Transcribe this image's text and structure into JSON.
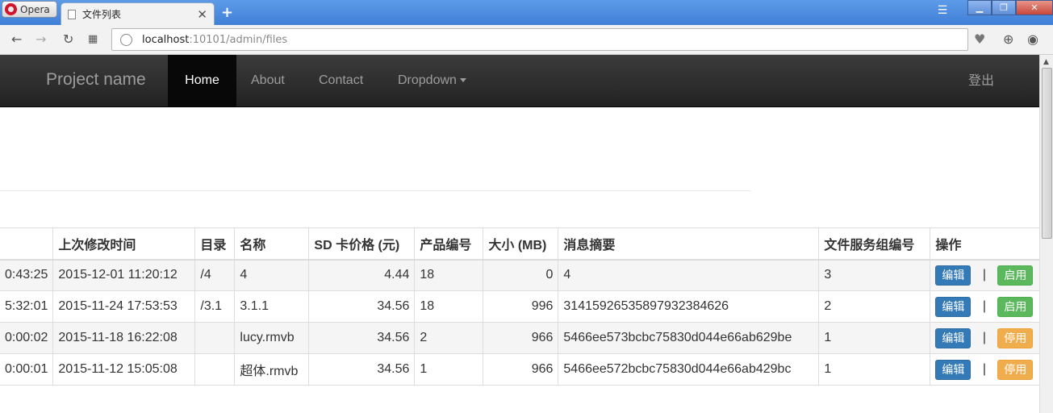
{
  "browser": {
    "opera_label": "Opera",
    "tab_title": "文件列表",
    "url_host": "localhost",
    "url_path": ":10101/admin/files"
  },
  "navbar": {
    "brand": "Project name",
    "items": [
      {
        "label": "Home",
        "active": true
      },
      {
        "label": "About"
      },
      {
        "label": "Contact"
      },
      {
        "label": "Dropdown"
      }
    ],
    "logout": "登出"
  },
  "table": {
    "headers": [
      "",
      "上次修改时间",
      "目录",
      "名称",
      "SD 卡价格 (元)",
      "产品编号",
      "大小 (MB)",
      "消息摘要",
      "文件服务组编号",
      "操作"
    ],
    "rows": [
      {
        "created": "0:43:25",
        "modified": "2015-12-01 11:20:12",
        "dir": "/4",
        "name": "4",
        "price": "4.44",
        "product": "18",
        "size": "0",
        "digest": "4",
        "group": "3",
        "edit": "编辑",
        "sep": "|",
        "toggle": "启用",
        "toggle_state": "enable"
      },
      {
        "created": "5:32:01",
        "modified": "2015-11-24 17:53:53",
        "dir": "/3.1",
        "name": "3.1.1",
        "price": "34.56",
        "product": "18",
        "size": "996",
        "digest": "31415926535897932384626",
        "group": "2",
        "edit": "编辑",
        "sep": "|",
        "toggle": "启用",
        "toggle_state": "enable"
      },
      {
        "created": "0:00:02",
        "modified": "2015-11-18 16:22:08",
        "dir": "",
        "name": "lucy.rmvb",
        "price": "34.56",
        "product": "2",
        "size": "966",
        "digest": "5466ee573bcbc75830d044e66ab629be",
        "group": "1",
        "edit": "编辑",
        "sep": "|",
        "toggle": "停用",
        "toggle_state": "disable"
      },
      {
        "created": "0:00:01",
        "modified": "2015-11-12 15:05:08",
        "dir": "",
        "name": "超体.rmvb",
        "price": "34.56",
        "product": "1",
        "size": "966",
        "digest": "5466ee572bcbc75830d044e66ab429bc",
        "group": "1",
        "edit": "编辑",
        "sep": "|",
        "toggle": "停用",
        "toggle_state": "disable"
      }
    ]
  },
  "colors": {
    "edit": "#337ab7",
    "enable": "#5cb85c",
    "disable": "#f0ad4e",
    "navbar": "#222222"
  }
}
